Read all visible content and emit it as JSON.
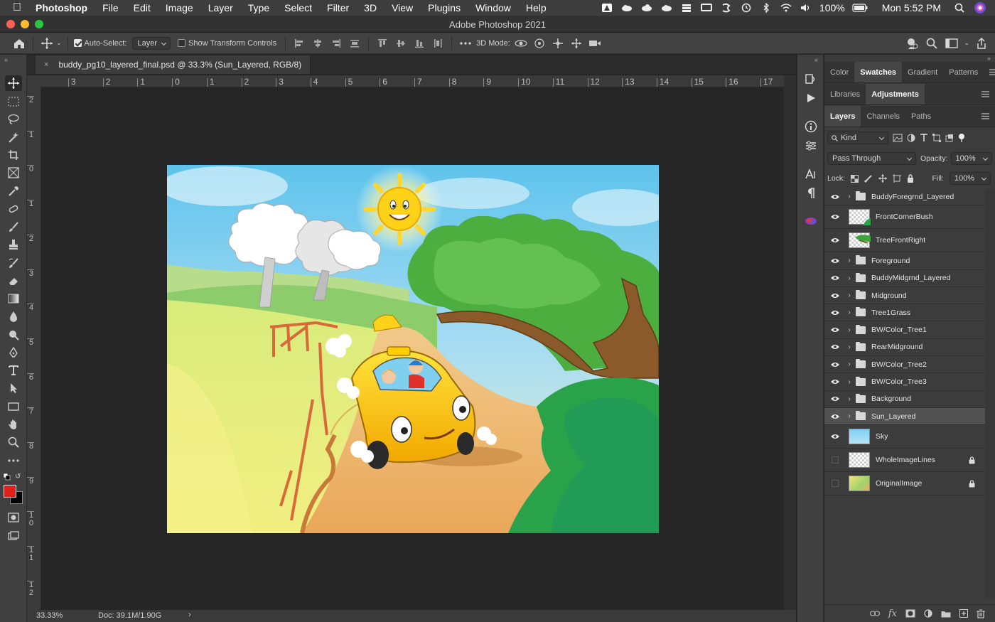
{
  "menubar": {
    "app_name": "Photoshop",
    "items": [
      "File",
      "Edit",
      "Image",
      "Layer",
      "Type",
      "Select",
      "Filter",
      "3D",
      "View",
      "Plugins",
      "Window",
      "Help"
    ],
    "battery": "100%",
    "clock": "Mon 5:52 PM"
  },
  "window": {
    "title": "Adobe Photoshop 2021"
  },
  "options": {
    "auto_select_label": "Auto-Select:",
    "auto_select_checked": true,
    "auto_select_target": "Layer",
    "show_transform_label": "Show Transform Controls",
    "show_transform_checked": false,
    "mode_3d_label": "3D Mode:"
  },
  "document": {
    "tab_title": "buddy_pg10_layered_final.psd @ 33.3% (Sun_Layered, RGB/8)",
    "close_glyph": "×"
  },
  "rulers": {
    "horizontal": [
      "3",
      "2",
      "1",
      "0",
      "1",
      "2",
      "3",
      "4",
      "5",
      "6",
      "7",
      "8",
      "9",
      "10",
      "11",
      "12",
      "13",
      "14",
      "15",
      "16",
      "17"
    ],
    "vertical": [
      "2",
      "1",
      "0",
      "1",
      "2",
      "3",
      "4",
      "5",
      "6",
      "7",
      "8",
      "9",
      "1 0",
      "1 1",
      "1 2"
    ]
  },
  "status": {
    "zoom": "33.33%",
    "doc_size": "Doc: 39.1M/1.90G",
    "arrow": "›"
  },
  "colors": {
    "foreground": "#e0201c",
    "background": "#000000",
    "panel": "#3c3c3c",
    "selected_layer": "#525252"
  },
  "panels": {
    "row1_tabs": [
      "Color",
      "Swatches",
      "Gradient",
      "Patterns"
    ],
    "row1_active": "Swatches",
    "row2_tabs": [
      "Libraries",
      "Adjustments"
    ],
    "row2_active": "Adjustments",
    "row3_tabs": [
      "Layers",
      "Channels",
      "Paths"
    ],
    "row3_active": "Layers"
  },
  "layers_panel": {
    "filter_kind": "Kind",
    "blend_mode": "Pass Through",
    "opacity_label": "Opacity:",
    "opacity_value": "100%",
    "lock_label": "Lock:",
    "fill_label": "Fill:",
    "fill_value": "100%",
    "layers": [
      {
        "name": "BuddyForegrnd_Layered",
        "type": "group",
        "visible": true
      },
      {
        "name": "FrontCornerBush",
        "type": "layer",
        "thumb": "bush",
        "visible": true
      },
      {
        "name": "TreeFrontRight",
        "type": "layer",
        "thumb": "tree",
        "visible": true
      },
      {
        "name": "Foreground",
        "type": "group",
        "visible": true
      },
      {
        "name": "BuddyMidgrnd_Layered",
        "type": "group",
        "visible": true
      },
      {
        "name": "Midground",
        "type": "group",
        "visible": true
      },
      {
        "name": "Tree1Grass",
        "type": "group",
        "visible": true
      },
      {
        "name": "BW/Color_Tree1",
        "type": "group",
        "visible": true
      },
      {
        "name": "RearMidground",
        "type": "group",
        "visible": true
      },
      {
        "name": "BW/Color_Tree2",
        "type": "group",
        "visible": true
      },
      {
        "name": "BW/Color_Tree3",
        "type": "group",
        "visible": true
      },
      {
        "name": "Background",
        "type": "group",
        "visible": true
      },
      {
        "name": "Sun_Layered",
        "type": "group",
        "visible": true,
        "selected": true
      },
      {
        "name": "Sky",
        "type": "layer",
        "thumb": "sky",
        "visible": true
      },
      {
        "name": "WholeImageLines",
        "type": "layer",
        "thumb": "lines",
        "visible": false,
        "locked": true
      },
      {
        "name": "OriginalImage",
        "type": "layer",
        "thumb": "original",
        "visible": false,
        "locked": true
      }
    ]
  }
}
